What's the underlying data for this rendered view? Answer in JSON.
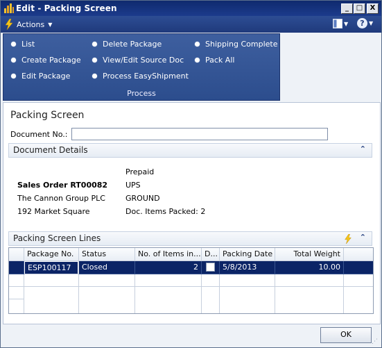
{
  "window": {
    "title": "Edit - Packing Screen",
    "controls": {
      "minimize": "_",
      "maximize": "□",
      "close": "X"
    }
  },
  "command_bar": {
    "actions_label": "Actions",
    "help_symbol": "?"
  },
  "ribbon": {
    "items": [
      {
        "label": "List"
      },
      {
        "label": "Create Package"
      },
      {
        "label": "Edit Package"
      },
      {
        "label": "Delete Package"
      },
      {
        "label": "View/Edit Source Doc"
      },
      {
        "label": "Process EasyShipment"
      },
      {
        "label": "Shipping Complete"
      },
      {
        "label": "Pack All"
      }
    ],
    "group_label": "Process"
  },
  "page": {
    "heading": "Packing Screen",
    "document_no_label": "Document No.:",
    "document_no_value": ""
  },
  "document_details": {
    "header": "Document Details",
    "left": [
      "Sales Order RT00082",
      "The Cannon Group PLC",
      "192 Market Square"
    ],
    "right": [
      "Prepaid",
      "UPS",
      "GROUND",
      "Doc. Items Packed: 2"
    ]
  },
  "packing_lines": {
    "header": "Packing Screen Lines",
    "columns": [
      "Package No.",
      "Status",
      "No. of Items in...",
      "D...",
      "Packing Date",
      "Total Weight"
    ],
    "rows": [
      {
        "package_no": "ESP100117",
        "status": "Closed",
        "items": "2",
        "d": false,
        "packing_date": "5/8/2013",
        "total_weight": "10.00"
      }
    ]
  },
  "footer": {
    "ok_label": "OK"
  },
  "colors": {
    "title_bar": "#0f2a6e",
    "ribbon": "#2c4d8d",
    "selected_row": "#0b2466"
  }
}
